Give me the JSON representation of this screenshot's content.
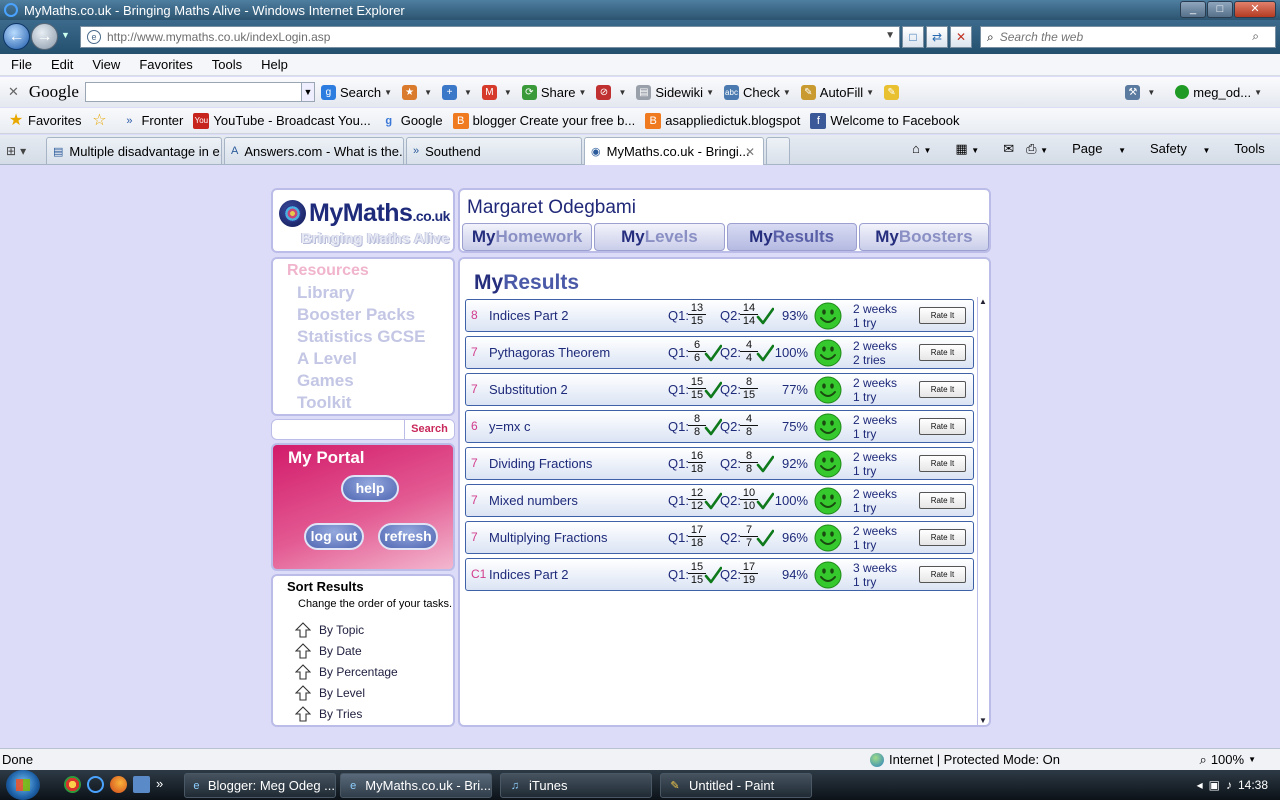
{
  "window": {
    "title": "MyMaths.co.uk - Bringing Maths Alive - Windows Internet Explorer",
    "controls": [
      "_",
      "□",
      "✕"
    ]
  },
  "address": {
    "url": "http://www.mymaths.co.uk/indexLogin.asp",
    "search_placeholder": "Search the web"
  },
  "menu": [
    "File",
    "Edit",
    "View",
    "Favorites",
    "Tools",
    "Help"
  ],
  "google_toolbar": {
    "logo": "Google",
    "buttons": [
      "Search",
      "Share",
      "Sidewiki",
      "Check",
      "AutoFill"
    ],
    "account": "meg_od..."
  },
  "favorites": {
    "label": "Favorites",
    "items": [
      "Fronter",
      "YouTube - Broadcast You...",
      "Google",
      "blogger Create your free b...",
      "asappliedictuk.blogspot",
      "Welcome to Facebook"
    ]
  },
  "tabs": [
    {
      "label": "Multiple disadvantage in e..."
    },
    {
      "label": "Answers.com - What is the..."
    },
    {
      "label": "Southend"
    },
    {
      "label": "MyMaths.co.uk - Bringi..."
    }
  ],
  "command_bar": {
    "page": "Page",
    "safety": "Safety",
    "tools": "Tools"
  },
  "site": {
    "logo_main": "MyMaths",
    "logo_suffix": ".co.uk",
    "tagline": "Bringing Maths Alive",
    "user_name": "Margaret Odegbami",
    "nav": [
      {
        "my": "My",
        "rest": "Homework"
      },
      {
        "my": "My",
        "rest": "Levels"
      },
      {
        "my": "My",
        "rest": "Results"
      },
      {
        "my": "My",
        "rest": "Boosters"
      }
    ],
    "resources_heading": "Resources",
    "resources": [
      "Library",
      "Booster Packs",
      "Statistics GCSE",
      "A Level",
      "Games",
      "Toolkit"
    ],
    "search_button": "Search",
    "portal_title": "My Portal",
    "portal_buttons": {
      "help": "help",
      "logout": "log out",
      "refresh": "refresh"
    },
    "sort_title": "Sort Results",
    "sort_subtitle": "Change the order of your tasks.",
    "sort_options": [
      "By Topic",
      "By Date",
      "By Percentage",
      "By Level",
      "By Tries"
    ],
    "results_title_my": "My",
    "results_title_rest": "Results",
    "rate_label": "Rate It",
    "q1_label": "Q1:",
    "q2_label": "Q2:"
  },
  "results": [
    {
      "level": "8",
      "topic": "Indices Part 2",
      "q1": [
        "13",
        "15"
      ],
      "q1_tick": false,
      "q2": [
        "14",
        "14"
      ],
      "q2_tick": true,
      "pct": "93%",
      "time": "2 weeks",
      "tries": "1 try"
    },
    {
      "level": "7",
      "topic": "Pythagoras Theorem",
      "q1": [
        "6",
        "6"
      ],
      "q1_tick": true,
      "q2": [
        "4",
        "4"
      ],
      "q2_tick": true,
      "pct": "100%",
      "time": "2 weeks",
      "tries": "2 tries"
    },
    {
      "level": "7",
      "topic": "Substitution 2",
      "q1": [
        "15",
        "15"
      ],
      "q1_tick": true,
      "q2": [
        "8",
        "15"
      ],
      "q2_tick": false,
      "pct": "77%",
      "time": "2 weeks",
      "tries": "1 try"
    },
    {
      "level": "6",
      "topic": "y=mx c",
      "q1": [
        "8",
        "8"
      ],
      "q1_tick": true,
      "q2": [
        "4",
        "8"
      ],
      "q2_tick": false,
      "pct": "75%",
      "time": "2 weeks",
      "tries": "1 try"
    },
    {
      "level": "7",
      "topic": "Dividing Fractions",
      "q1": [
        "16",
        "18"
      ],
      "q1_tick": false,
      "q2": [
        "8",
        "8"
      ],
      "q2_tick": true,
      "pct": "92%",
      "time": "2 weeks",
      "tries": "1 try"
    },
    {
      "level": "7",
      "topic": "Mixed numbers",
      "q1": [
        "12",
        "12"
      ],
      "q1_tick": true,
      "q2": [
        "10",
        "10"
      ],
      "q2_tick": true,
      "pct": "100%",
      "time": "2 weeks",
      "tries": "1 try"
    },
    {
      "level": "7",
      "topic": "Multiplying Fractions",
      "q1": [
        "17",
        "18"
      ],
      "q1_tick": false,
      "q2": [
        "7",
        "7"
      ],
      "q2_tick": true,
      "pct": "96%",
      "time": "2 weeks",
      "tries": "1 try"
    },
    {
      "level": "C1",
      "topic": "Indices Part 2",
      "q1": [
        "15",
        "15"
      ],
      "q1_tick": true,
      "q2": [
        "17",
        "19"
      ],
      "q2_tick": false,
      "pct": "94%",
      "time": "3 weeks",
      "tries": "1 try"
    }
  ],
  "status": {
    "left": "Done",
    "zone": "Internet | Protected Mode: On",
    "zoom": "100%"
  },
  "taskbar": {
    "items": [
      "Blogger: Meg Odeg ...",
      "MyMaths.co.uk - Bri...",
      "iTunes",
      "Untitled - Paint"
    ],
    "clock": "14:38"
  },
  "colors": {
    "page_bg": "#dcdcf8",
    "brand_navy": "#1e2a7a",
    "level_pink": "#d23c8c",
    "portal_pink": "#d21b6b",
    "smiley_green": "#35c92e",
    "tick_green": "#0f7a1c"
  }
}
